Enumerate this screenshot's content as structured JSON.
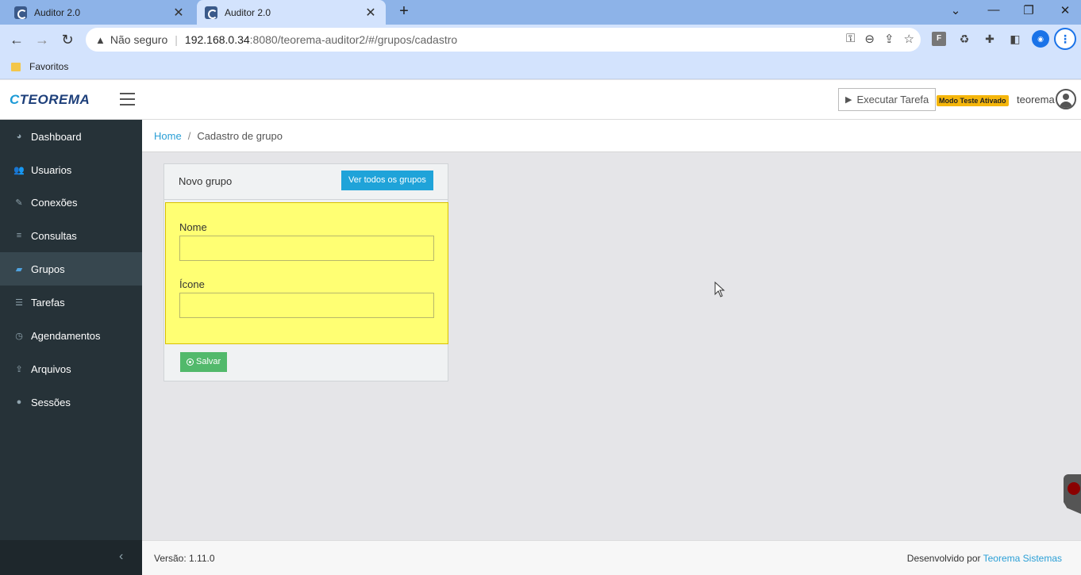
{
  "browser": {
    "tabs": [
      {
        "title": "Auditor 2.0"
      },
      {
        "title": "Auditor 2.0"
      }
    ],
    "new_tab": "+",
    "close_glyph": "✕",
    "window_controls": {
      "minimize": "⌄",
      "restore": "—",
      "maximize": "❐",
      "close": "✕"
    },
    "nav": {
      "back": "←",
      "forward": "→",
      "reload": "↻"
    },
    "address": {
      "security_icon": "▲",
      "security_label": "Não seguro",
      "separator": "|",
      "host": "192.168.0.34",
      "path": ":8080/teorema-auditor2/#/grupos/cadastro"
    },
    "bookmarks": [
      {
        "label": "Favoritos"
      }
    ]
  },
  "app": {
    "logo": {
      "prefix": "C",
      "text": "TEOREMA"
    },
    "exec_button": "Executar Tarefa",
    "play_glyph": "▶",
    "test_badge": "Modo Teste Ativado",
    "username": "teorema"
  },
  "sidebar": {
    "items": [
      {
        "label": "Dashboard",
        "icon": "◕"
      },
      {
        "label": "Usuarios",
        "icon": "👥"
      },
      {
        "label": "Conexões",
        "icon": "✎"
      },
      {
        "label": "Consultas",
        "icon": "≡"
      },
      {
        "label": "Grupos",
        "icon": "▰"
      },
      {
        "label": "Tarefas",
        "icon": "☰"
      },
      {
        "label": "Agendamentos",
        "icon": "◷"
      },
      {
        "label": "Arquivos",
        "icon": "⇪"
      },
      {
        "label": "Sessões",
        "icon": "●"
      }
    ],
    "active_index": 4,
    "collapse_glyph": "‹"
  },
  "breadcrumb": {
    "home": "Home",
    "separator": "/",
    "current": "Cadastro de grupo"
  },
  "card": {
    "title": "Novo grupo",
    "view_all_button": "Ver todos os grupos",
    "fields": [
      {
        "label": "Nome",
        "value": ""
      },
      {
        "label": "Ícone",
        "value": ""
      }
    ],
    "save_button": "Salvar"
  },
  "footer": {
    "version": "Versão: 1.11.0",
    "developed_by": "Desenvolvido por",
    "company": "Teorema Sistemas"
  },
  "colors": {
    "sidebar_bg": "#263238",
    "highlight": "#ffff73",
    "info": "#1fa3d9",
    "success": "#52b96b",
    "badge": "#f5b60b",
    "link": "#2a9fd6"
  }
}
